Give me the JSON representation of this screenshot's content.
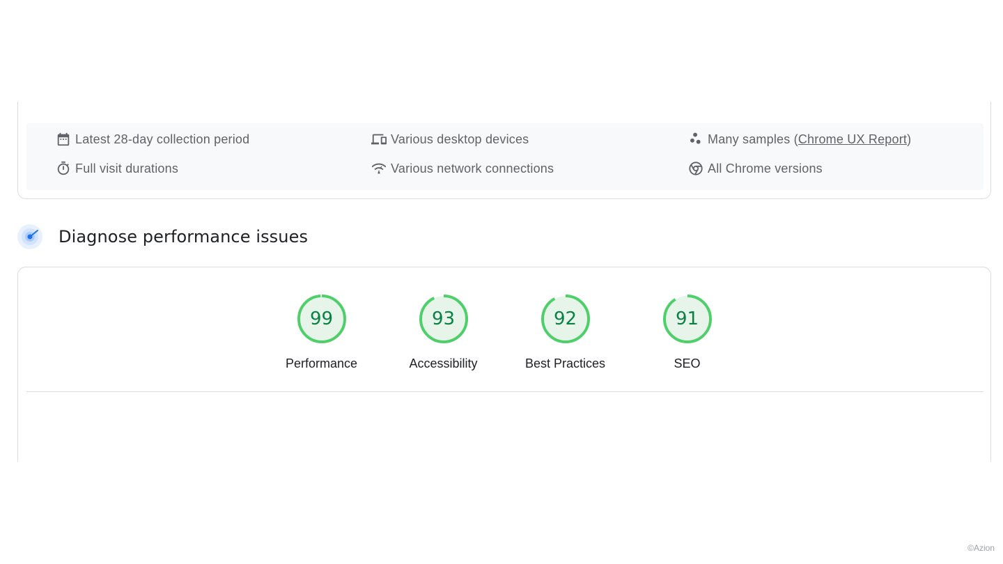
{
  "field_data": {
    "items": [
      {
        "icon": "calendar-icon",
        "label": "Latest 28-day collection period"
      },
      {
        "icon": "devices-icon",
        "label": "Various desktop devices"
      },
      {
        "icon": "samples-icon",
        "label_prefix": "Many samples (",
        "link": "Chrome UX Report",
        "label_suffix": ")"
      },
      {
        "icon": "stopwatch-icon",
        "label": "Full visit durations"
      },
      {
        "icon": "network-icon",
        "label": "Various network connections"
      },
      {
        "icon": "chrome-icon",
        "label": "All Chrome versions"
      }
    ]
  },
  "diagnose": {
    "title": "Diagnose performance issues",
    "icon": "lighthouse-icon"
  },
  "scores": [
    {
      "value": 99,
      "label": "Performance"
    },
    {
      "value": 93,
      "label": "Accessibility"
    },
    {
      "value": 92,
      "label": "Best Practices"
    },
    {
      "value": 91,
      "label": "SEO"
    }
  ],
  "colors": {
    "pass_ring": "#4fcf6a",
    "pass_fill": "#e6f4ea",
    "pass_text": "#0b8043",
    "accent_blue": "#1a73e8"
  },
  "watermark": "©Azion"
}
